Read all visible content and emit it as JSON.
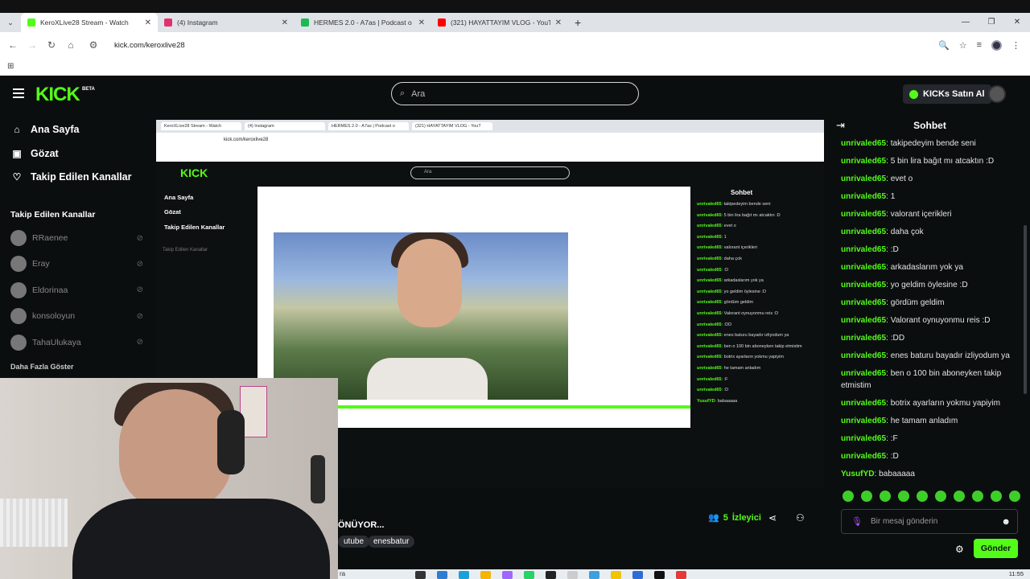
{
  "browser": {
    "tabs": [
      {
        "title": "KeroXLive28 Stream - Watch",
        "color": "#53fc18"
      },
      {
        "title": "(4) Instagram",
        "color": "#e1306c"
      },
      {
        "title": "HERMES 2.0 - A7as | Podcast o",
        "color": "#1db954"
      },
      {
        "title": "(321) HAYATTAYIM VLOG - YouT",
        "color": "#ff0000"
      }
    ],
    "url": "kick.com/keroxlive28"
  },
  "header": {
    "logo": "KICK",
    "logo_badge": "BETA",
    "search_placeholder": "Ara",
    "buy_kicks": "KICKs Satın Al"
  },
  "sidebar": {
    "nav": [
      {
        "label": "Ana Sayfa",
        "icon": "home-icon"
      },
      {
        "label": "Gözat",
        "icon": "browse-icon"
      },
      {
        "label": "Takip Edilen Kanallar",
        "icon": "heart-icon"
      }
    ],
    "follow_title": "Takip Edilen Kanallar",
    "channels": [
      "RRaenee",
      "Eray",
      "Eldorinaa",
      "konsoloyun",
      "TahaUlukaya"
    ],
    "more": "Daha Fazla Göster"
  },
  "stream": {
    "title_fragment": "ÖNÜYOR...",
    "tags": [
      "utube",
      "enesbatur"
    ],
    "viewers_count": "5",
    "viewers_label": "İzleyici"
  },
  "chat": {
    "title": "Sohbet",
    "messages": [
      {
        "user": "unrivaled65",
        "text": "takipedeyim bende seni"
      },
      {
        "user": "unrivaled65",
        "text": "5 bin lira bağıt mı atcaktın :D"
      },
      {
        "user": "unrivaled65",
        "text": "evet o"
      },
      {
        "user": "unrivaled65",
        "text": "1"
      },
      {
        "user": "unrivaled65",
        "text": "valorant içerikleri"
      },
      {
        "user": "unrivaled65",
        "text": "daha çok"
      },
      {
        "user": "unrivaled65",
        "text": ":D"
      },
      {
        "user": "unrivaled65",
        "text": "arkadaslarım yok ya"
      },
      {
        "user": "unrivaled65",
        "text": "yo geldim öylesine :D"
      },
      {
        "user": "unrivaled65",
        "text": "gördüm geldim"
      },
      {
        "user": "unrivaled65",
        "text": "Valorant oynuyonmu reis :D"
      },
      {
        "user": "unrivaled65",
        "text": ":DD"
      },
      {
        "user": "unrivaled65",
        "text": "enes baturu bayadır izliyodum ya"
      },
      {
        "user": "unrivaled65",
        "text": "ben o 100 bin aboneyken takip etmistim"
      },
      {
        "user": "unrivaled65",
        "text": "botrix ayarların yokmu yapiyim"
      },
      {
        "user": "unrivaled65",
        "text": "he tamam anladım"
      },
      {
        "user": "unrivaled65",
        "text": ":F"
      },
      {
        "user": "unrivaled65",
        "text": ":D"
      },
      {
        "user": "YusufYD",
        "text": "babaaaaa"
      }
    ],
    "input_placeholder": "Bir mesaj gönderin",
    "send_label": "Gönder"
  },
  "taskbar": {
    "search_fragment": "ra",
    "time": "11:55"
  },
  "colors": {
    "accent": "#53fc18",
    "background": "#0b0e0f"
  }
}
